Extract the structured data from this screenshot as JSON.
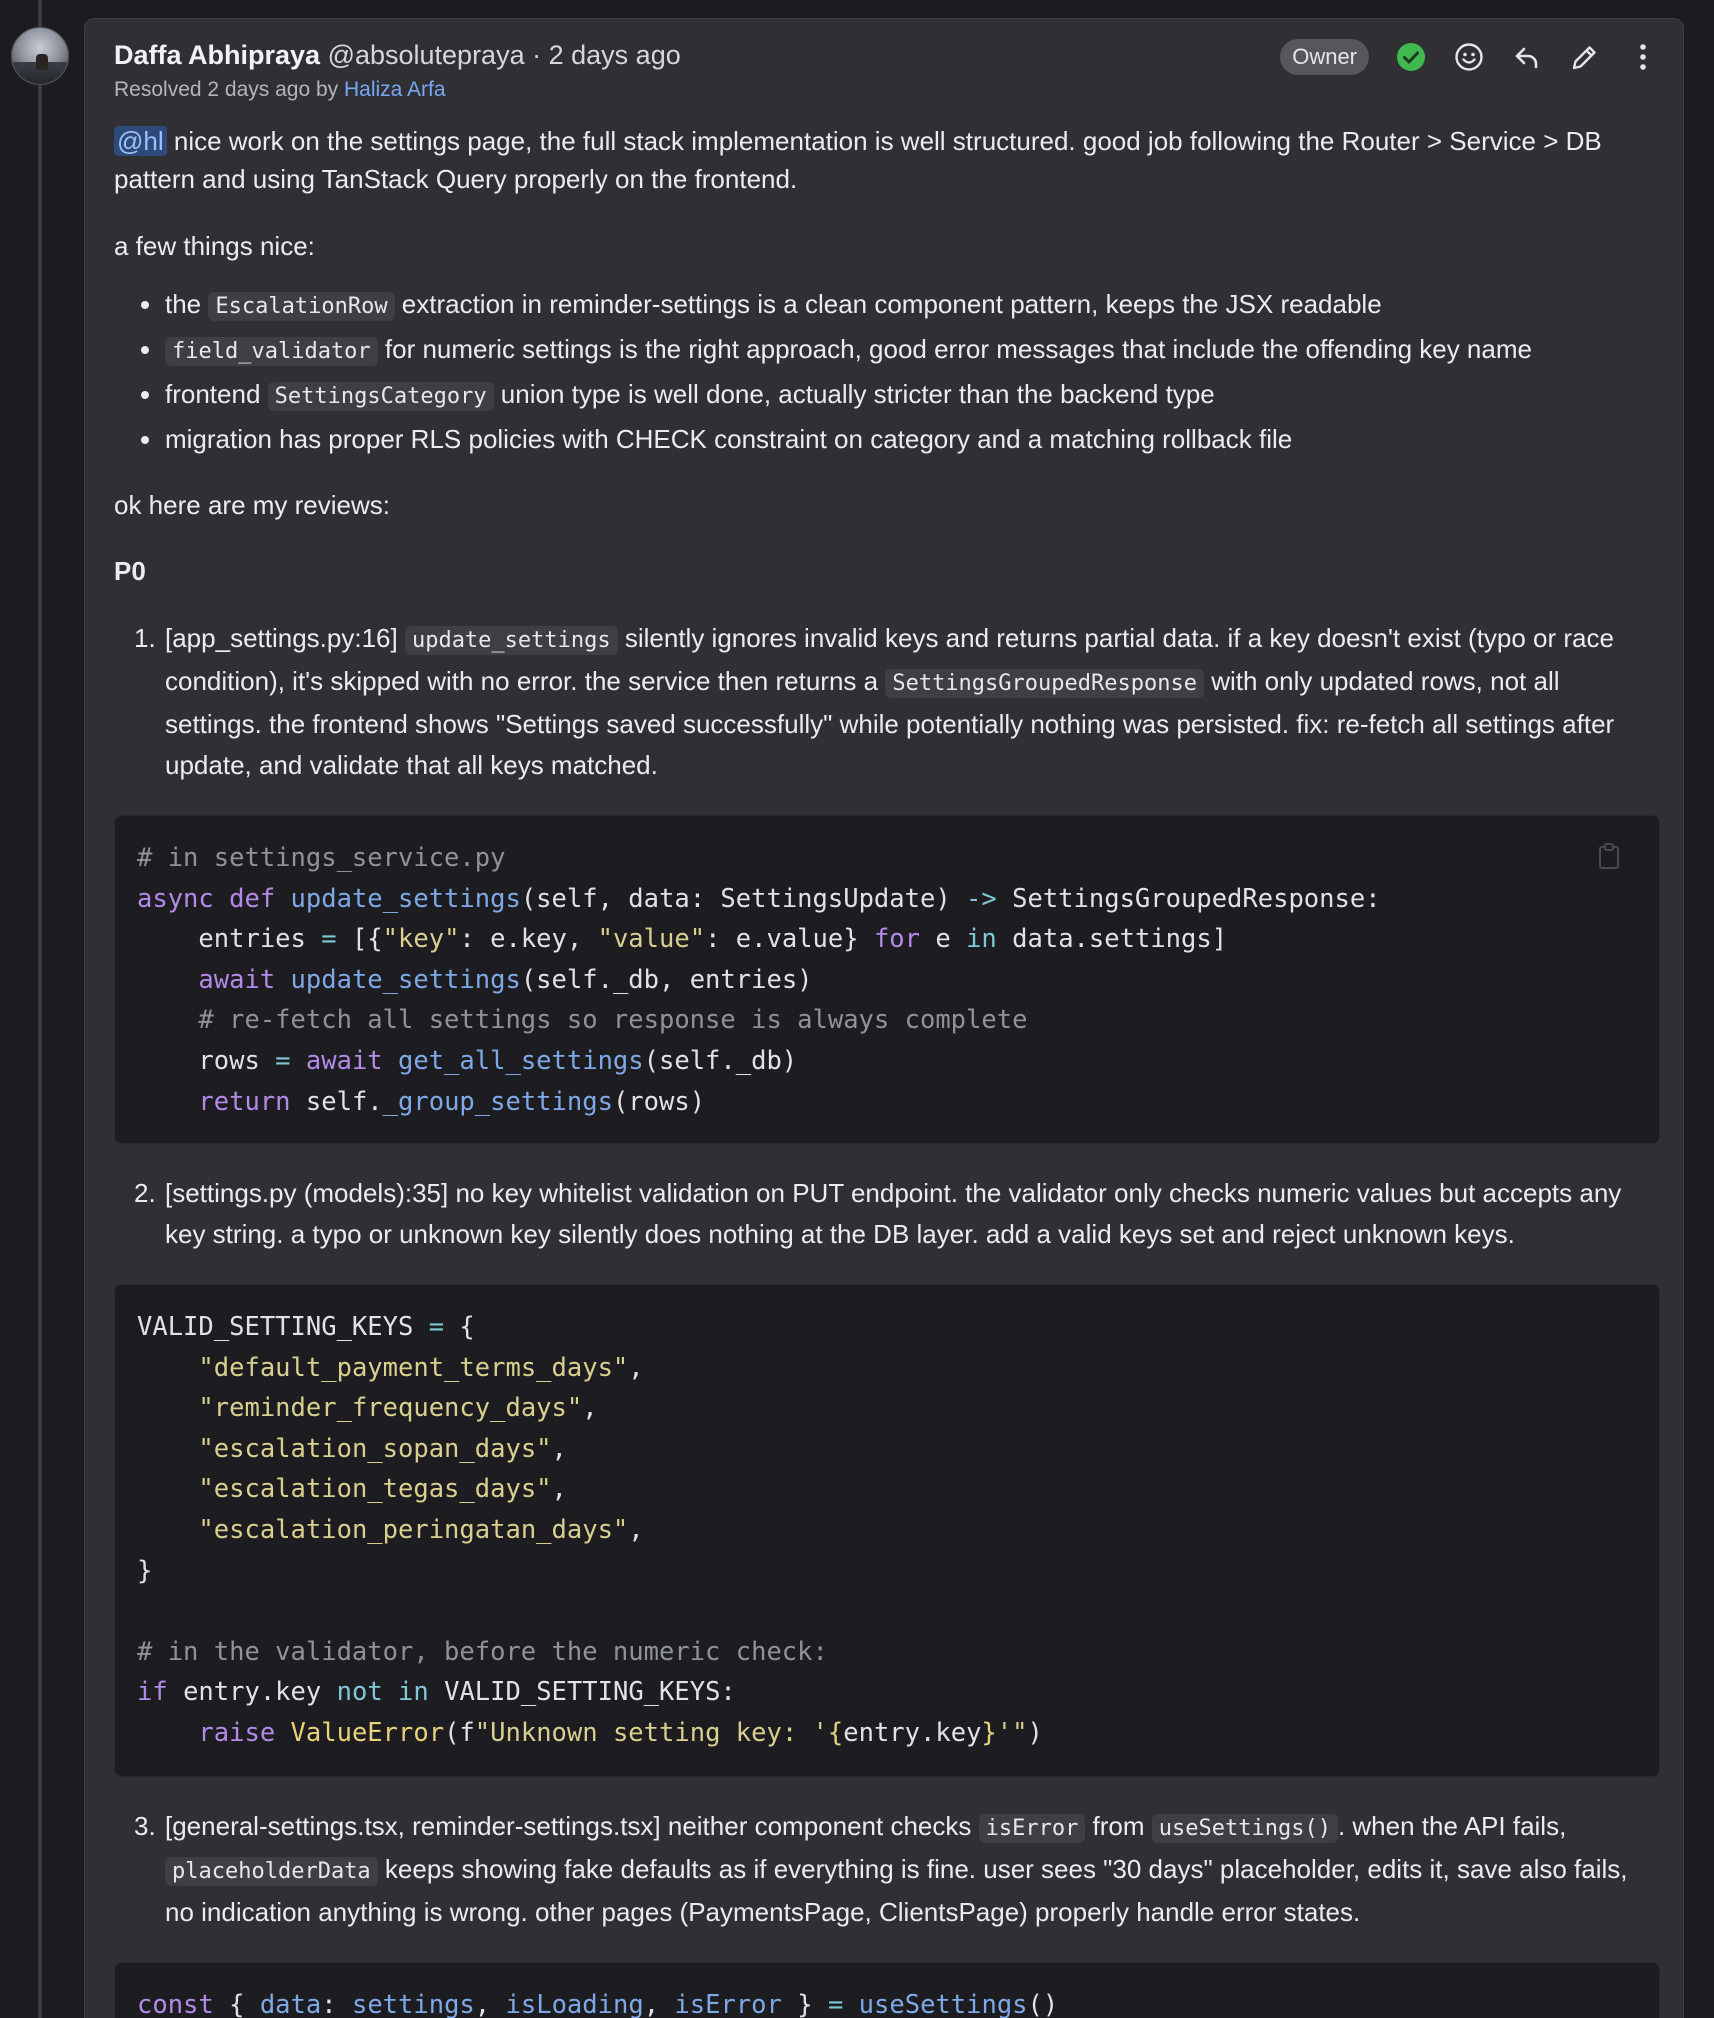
{
  "comment": {
    "author_name": "Daffa Abhipraya",
    "author_handle": "@absolutepraya",
    "separator": "·",
    "time_ago": "2 days ago",
    "resolved_prefix": "Resolved 2 days ago by",
    "resolved_by": "Haliza Arfa",
    "badge": "Owner"
  },
  "actions": {
    "resolved_icon": "check-circle-icon",
    "emoji_icon": "smiley-icon",
    "reply_icon": "reply-arrow-icon",
    "edit_icon": "pencil-icon",
    "more_icon": "kebab-menu-icon"
  },
  "body": {
    "intro_mention": "@hl",
    "intro_text": " nice work on the settings page, the full stack implementation is well structured. good job following the Router > Service > DB pattern and using TanStack Query properly on the frontend.",
    "nice_heading": "a few things nice:",
    "bullets": [
      {
        "pre": "the ",
        "code": "EscalationRow",
        "post": " extraction in reminder-settings is a clean component pattern, keeps the JSX readable"
      },
      {
        "pre": "",
        "code": "field_validator",
        "post": " for numeric settings is the right approach, good error messages that include the offending key name"
      },
      {
        "pre": "frontend ",
        "code": "SettingsCategory",
        "post": " union type is well done, actually stricter than the backend type"
      },
      {
        "pre": "migration has proper RLS policies with CHECK constraint on category and a matching rollback file",
        "code": "",
        "post": ""
      }
    ],
    "reviews_heading": "ok here are my reviews:",
    "priority": "P0",
    "items": [
      {
        "num": "1.",
        "pre": "[app_settings.py:16] ",
        "code1": "update_settings",
        "mid": " silently ignores invalid keys and returns partial data. if a key doesn't exist (typo or race condition), it's skipped with no error. the service then returns a ",
        "code2": "SettingsGroupedResponse",
        "post": " with only updated rows, not all settings. the frontend shows \"Settings saved successfully\" while potentially nothing was persisted. fix: re-fetch all settings after update, and validate that all keys matched."
      },
      {
        "num": "2.",
        "text": "[settings.py (models):35] no key whitelist validation on PUT endpoint. the validator only checks numeric values but accepts any key string. a typo or unknown key silently does nothing at the DB layer. add a valid keys set and reject unknown keys."
      },
      {
        "num": "3.",
        "pre": "[general-settings.tsx, reminder-settings.tsx] neither component checks ",
        "code1": "isError",
        "mid1": " from ",
        "code2": "useSettings()",
        "mid2": ". when the API fails, ",
        "code3": "placeholderData",
        "post": " keeps showing fake defaults as if everything is fine. user sees \"30 days\" placeholder, edits it, save also fails, no indication anything is wrong. other pages (PaymentsPage, ClientsPage) properly handle error states."
      }
    ],
    "code1": {
      "l1": "# in settings_service.py",
      "l2_kw": "async def ",
      "l2_fn": "update_settings",
      "l2_rest": "(self, data: SettingsUpdate) ",
      "l2_arrow": "->",
      "l2_ret": " SettingsGroupedResponse:",
      "l3_a": "    entries ",
      "l3_eq": "=",
      "l3_b": " [{",
      "l3_s1": "\"key\"",
      "l3_c": ": e.key, ",
      "l3_s2": "\"value\"",
      "l3_d": ": e.value} ",
      "l3_for": "for",
      "l3_e": " e ",
      "l3_in": "in",
      "l3_f": " data.settings]",
      "l4_kw": "    await ",
      "l4_fn": "update_settings",
      "l4_rest": "(self._db, entries)",
      "l5": "    # re-fetch all settings so response is always complete",
      "l6_a": "    rows ",
      "l6_eq": "=",
      "l6_kw": " await ",
      "l6_fn": "get_all_settings",
      "l6_rest": "(self._db)",
      "l7_kw": "    return",
      "l7_a": " self.",
      "l7_fn": "_group_settings",
      "l7_rest": "(rows)"
    },
    "code2": {
      "l1_a": "VALID_SETTING_KEYS ",
      "l1_eq": "=",
      "l1_b": " {",
      "keys": [
        "\"default_payment_terms_days\"",
        "\"reminder_frequency_days\"",
        "\"escalation_sopan_days\"",
        "\"escalation_tegas_days\"",
        "\"escalation_peringatan_days\""
      ],
      "comma": ",",
      "close": "}",
      "comment": "# in the validator, before the numeric check:",
      "if_kw": "if",
      "if_a": " entry.key ",
      "if_not": "not in",
      "if_b": " VALID_SETTING_KEYS:",
      "raise_kw": "    raise ",
      "raise_cls": "ValueError",
      "raise_a": "(f",
      "raise_s1": "\"Unknown setting key: '",
      "raise_br1": "{",
      "raise_v": "entry.key",
      "raise_br2": "}",
      "raise_s2": "'\"",
      "raise_b": ")"
    },
    "code3": {
      "kw": "const",
      "a": " { ",
      "v1": "data",
      "b": ": ",
      "v2": "settings",
      "c": ", ",
      "v3": "isLoading",
      "d": ", ",
      "v4": "isError",
      "e": " } ",
      "eq": "=",
      "f": " ",
      "fn": "useSettings",
      "g": "()"
    }
  }
}
